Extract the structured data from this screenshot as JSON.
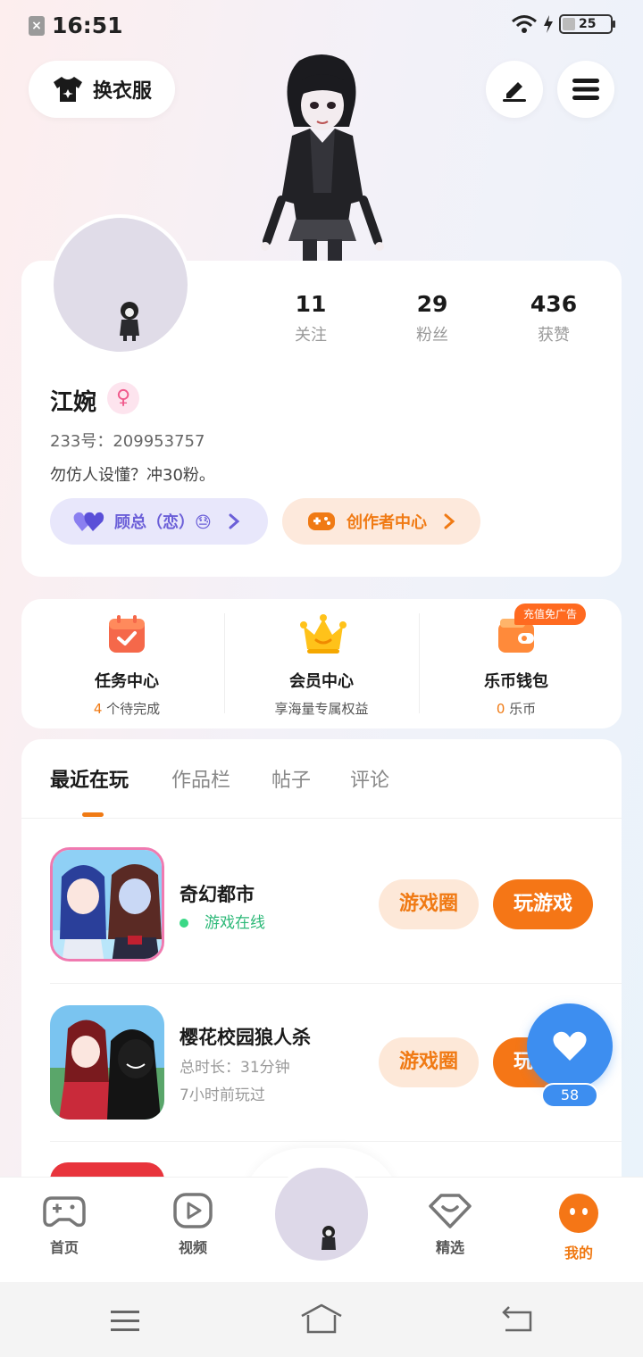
{
  "status_bar": {
    "time": "16:51",
    "battery": "25"
  },
  "header": {
    "outfit_label": "换衣服"
  },
  "profile": {
    "stats": [
      {
        "num": "11",
        "label": "关注"
      },
      {
        "num": "29",
        "label": "粉丝"
      },
      {
        "num": "436",
        "label": "获赞"
      }
    ],
    "name": "江婉",
    "id_text": "233号：209953757",
    "bio": "勿仿人设懂？冲30粉。",
    "partner_label": "顾总（恋）😓",
    "creator_label": "创作者中心"
  },
  "features": [
    {
      "name": "任务中心",
      "count": "4",
      "sub": "个待完成"
    },
    {
      "name": "会员中心",
      "sub": "享海量专属权益"
    },
    {
      "name": "乐币钱包",
      "count": "0",
      "sub": "乐币"
    }
  ],
  "ad_badge": "充值免广告",
  "tabs": [
    "最近在玩",
    "作品栏",
    "帖子",
    "评论"
  ],
  "games": [
    {
      "title": "奇幻都市",
      "status": "游戏在线",
      "circle_btn": "游戏圈",
      "play_btn": "玩游戏"
    },
    {
      "title": "樱花校园狼人杀",
      "duration": "总时长：31分钟",
      "last": "7小时前玩过",
      "circle_btn": "游戏圈",
      "play_btn": "玩游戏"
    }
  ],
  "like": {
    "count": "58"
  },
  "bottom_nav": [
    {
      "label": "首页"
    },
    {
      "label": "视频"
    },
    {
      "label": "精选"
    },
    {
      "label": "我的"
    }
  ],
  "colors": {
    "accent": "#f07a14",
    "like_blue": "#3d8ef0",
    "online_green": "#3ad886"
  }
}
